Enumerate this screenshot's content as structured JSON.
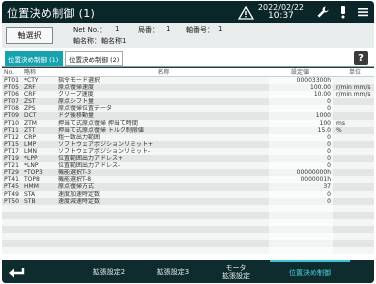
{
  "header": {
    "title": "位置決め制御 (1)",
    "date": "2022/02/22",
    "time": "10:37"
  },
  "info": {
    "axis_button": "軸選択",
    "net_no_label": "Net No.：",
    "net_no_value": "1",
    "station_label": "局番：",
    "station_value": "1",
    "axis_no_label": "軸番号：",
    "axis_no_value": "1",
    "axis_name": "軸名称：軸名称1"
  },
  "tabs": [
    {
      "label": "位置決め制御 (1)",
      "active": true
    },
    {
      "label": "位置決め制御 (2)",
      "active": false
    }
  ],
  "help_label": "?",
  "table": {
    "headers": {
      "no": "No.",
      "code": "略称",
      "name": "名称",
      "value": "設定値",
      "unit": "単位"
    },
    "rows": [
      {
        "no": "PT01",
        "code": "*CTY",
        "name": "指令モード選択",
        "value": "00003300h",
        "unit": ""
      },
      {
        "no": "PT05",
        "code": "ZRF",
        "name": "原点復帰速度",
        "value": "100.00",
        "unit": "r/min mm/s"
      },
      {
        "no": "PT06",
        "code": "CRF",
        "name": "クリープ速度",
        "value": "10.00",
        "unit": "r/min mm/s"
      },
      {
        "no": "PT07",
        "code": "ZST",
        "name": "原点シフト量",
        "value": "0",
        "unit": ""
      },
      {
        "no": "PT08",
        "code": "ZPS",
        "name": "原点復帰位置データ",
        "value": "0",
        "unit": ""
      },
      {
        "no": "PT09",
        "code": "DCT",
        "name": "ドグ後移動量",
        "value": "1000",
        "unit": ""
      },
      {
        "no": "PT10",
        "code": "ZTM",
        "name": "押当て式原点復帰 押当て時間",
        "value": "100",
        "unit": "ms"
      },
      {
        "no": "PT11",
        "code": "ZTT",
        "name": "押当て式原点復帰 トルク制限値",
        "value": "15.0",
        "unit": "%"
      },
      {
        "no": "PT12",
        "code": "CRP",
        "name": "粗一致出力範囲",
        "value": "0",
        "unit": ""
      },
      {
        "no": "PT15",
        "code": "LMP",
        "name": "ソフトウェアポジションリミット+",
        "value": "0",
        "unit": ""
      },
      {
        "no": "PT17",
        "code": "LMN",
        "name": "ソフトウェアポジションリミット-",
        "value": "0",
        "unit": ""
      },
      {
        "no": "PT19",
        "code": "*LPP",
        "name": "位置範囲出力アドレス+",
        "value": "0",
        "unit": ""
      },
      {
        "no": "PT21",
        "code": "*LNP",
        "name": "位置範囲出力アドレス-",
        "value": "0",
        "unit": ""
      },
      {
        "no": "PT29",
        "code": "*TOP3",
        "name": "機能選択T-3",
        "value": "00000000h",
        "unit": ""
      },
      {
        "no": "PT41",
        "code": "TOP8",
        "name": "機能選択T-8",
        "value": "0000001h",
        "unit": ""
      },
      {
        "no": "PT45",
        "code": "HMM",
        "name": "原点復帰方式",
        "value": "37",
        "unit": ""
      },
      {
        "no": "PT49",
        "code": "STA",
        "name": "速度加速時定数",
        "value": "0",
        "unit": ""
      },
      {
        "no": "PT50",
        "code": "STB",
        "name": "速度減速時定数",
        "value": "0",
        "unit": ""
      },
      {
        "no": "",
        "code": "",
        "name": "",
        "value": "",
        "unit": ""
      },
      {
        "no": "",
        "code": "",
        "name": "",
        "value": "",
        "unit": ""
      },
      {
        "no": "",
        "code": "",
        "name": "",
        "value": "",
        "unit": ""
      },
      {
        "no": "",
        "code": "",
        "name": "",
        "value": "",
        "unit": ""
      },
      {
        "no": "",
        "code": "",
        "name": "",
        "value": "",
        "unit": ""
      },
      {
        "no": "",
        "code": "",
        "name": "",
        "value": "",
        "unit": ""
      },
      {
        "no": "",
        "code": "",
        "name": "",
        "value": "",
        "unit": ""
      }
    ]
  },
  "footer": {
    "buttons": [
      {
        "label": "拡張設定2",
        "active": false
      },
      {
        "label": "拡張設定3",
        "active": false
      },
      {
        "label": "モータ\n拡張設定",
        "active": false
      },
      {
        "label": "位置決め制御",
        "active": true
      }
    ]
  },
  "colors": {
    "accent": "#16a2ae",
    "header_bg": "#0b2628",
    "frame_bg": "#1e3f40"
  },
  "icons": [
    "warning-icon",
    "wrench-icon",
    "status-light-icon",
    "menu-icon",
    "back-arrow-icon",
    "help-icon"
  ]
}
